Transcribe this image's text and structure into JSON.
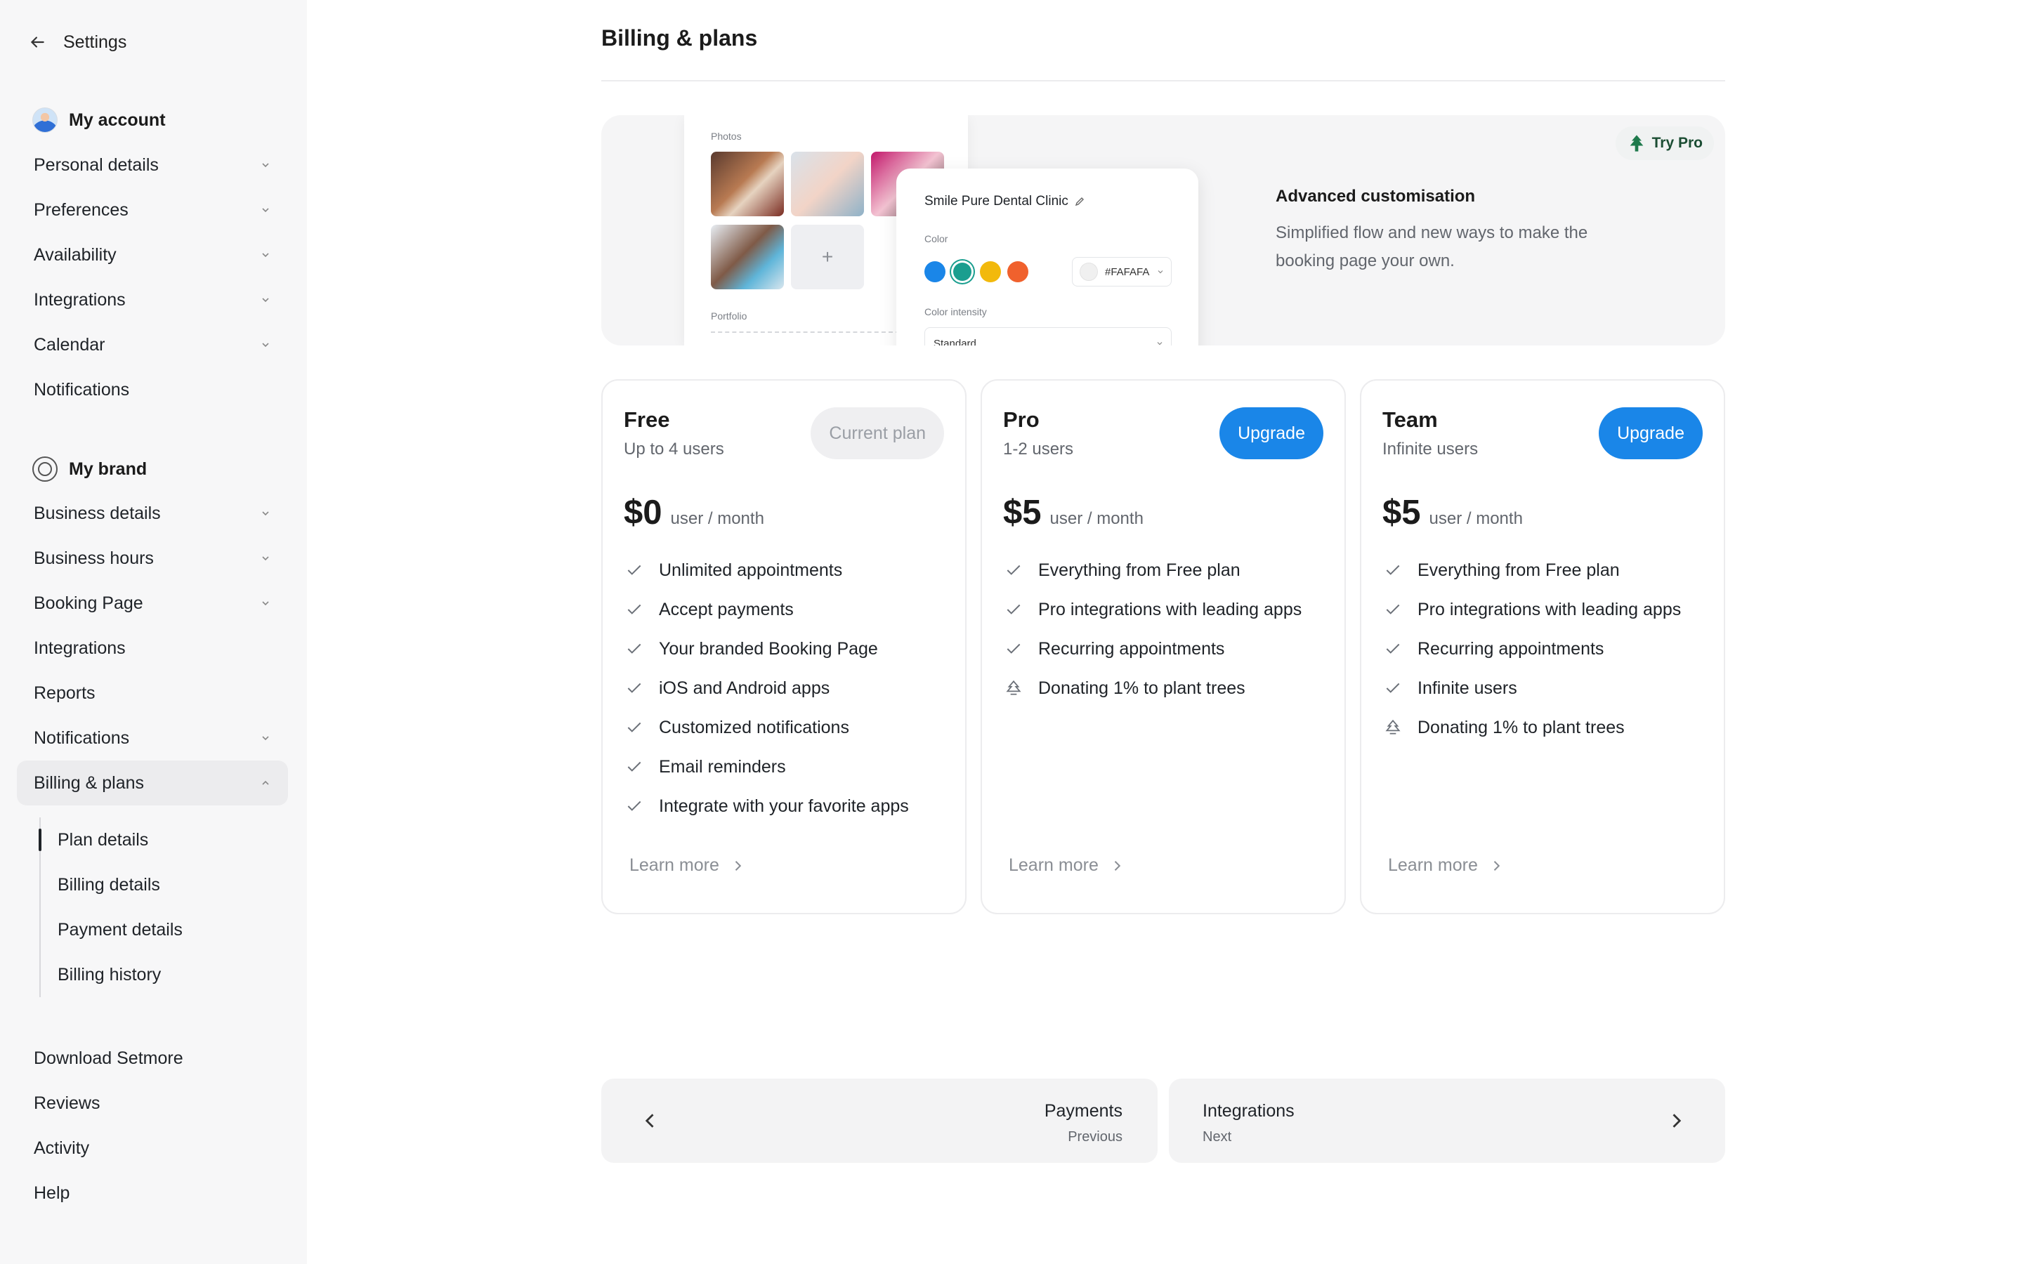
{
  "sidebar": {
    "back_label": "Settings",
    "my_account": {
      "title": "My account",
      "items": [
        {
          "label": "Personal details",
          "expandable": true
        },
        {
          "label": "Preferences",
          "expandable": true
        },
        {
          "label": "Availability",
          "expandable": true
        },
        {
          "label": "Integrations",
          "expandable": true
        },
        {
          "label": "Calendar",
          "expandable": true
        },
        {
          "label": "Notifications",
          "expandable": false
        }
      ]
    },
    "my_brand": {
      "title": "My brand",
      "items": [
        {
          "label": "Business details",
          "expandable": true
        },
        {
          "label": "Business hours",
          "expandable": true
        },
        {
          "label": "Booking Page",
          "expandable": true
        },
        {
          "label": "Integrations",
          "expandable": false
        },
        {
          "label": "Reports",
          "expandable": false
        },
        {
          "label": "Notifications",
          "expandable": true
        },
        {
          "label": "Billing & plans",
          "expandable": true,
          "expanded": true
        }
      ],
      "billing_sub": [
        "Plan details",
        "Billing details",
        "Payment details",
        "Billing history"
      ]
    },
    "footer_items": [
      "Download Setmore",
      "Reviews",
      "Activity",
      "Help"
    ]
  },
  "main": {
    "title": "Billing & plans",
    "promo": {
      "badge": "Try Pro",
      "title": "Advanced customisation",
      "description": "Simplified flow and new ways to make the booking page your own.",
      "mock": {
        "photos_label": "Photos",
        "portfolio_label": "Portfolio",
        "clinic_name": "Smile Pure Dental Clinic",
        "color_label": "Color",
        "hex_value": "#FAFAFA",
        "intensity_label": "Color intensity",
        "intensity_value": "Standard",
        "swatches": [
          "#1a86e8",
          "#1a9e8f",
          "#f2b90c",
          "#f0612d"
        ]
      }
    },
    "plans": [
      {
        "name": "Free",
        "users": "Up to 4 users",
        "button": "Current plan",
        "price": "$0",
        "unit": "user / month",
        "features": [
          {
            "text": "Unlimited appointments",
            "icon": "check-icon"
          },
          {
            "text": "Accept payments",
            "icon": "check-icon"
          },
          {
            "text": "Your branded Booking Page",
            "icon": "check-icon"
          },
          {
            "text": "iOS and Android apps",
            "icon": "check-icon"
          },
          {
            "text": "Customized notifications",
            "icon": "check-icon"
          },
          {
            "text": "Email reminders",
            "icon": "check-icon"
          },
          {
            "text": "Integrate with your favorite apps",
            "icon": "check-icon"
          }
        ],
        "learn_more": "Learn more"
      },
      {
        "name": "Pro",
        "users": "1-2 users",
        "button": "Upgrade",
        "price": "$5",
        "unit": "user / month",
        "features": [
          {
            "text": "Everything from Free plan",
            "icon": "check-icon"
          },
          {
            "text": "Pro integrations with leading apps",
            "icon": "check-icon"
          },
          {
            "text": "Recurring appointments",
            "icon": "check-icon"
          },
          {
            "text": "Donating 1% to plant trees",
            "icon": "tree-icon"
          }
        ],
        "learn_more": "Learn more"
      },
      {
        "name": "Team",
        "users": "Infinite users",
        "button": "Upgrade",
        "price": "$5",
        "unit": "user / month",
        "features": [
          {
            "text": "Everything from Free plan",
            "icon": "check-icon"
          },
          {
            "text": "Pro integrations with leading apps",
            "icon": "check-icon"
          },
          {
            "text": "Recurring appointments",
            "icon": "check-icon"
          },
          {
            "text": "Infinite users",
            "icon": "check-icon"
          },
          {
            "text": "Donating 1% to plant trees",
            "icon": "tree-icon"
          }
        ],
        "learn_more": "Learn more"
      }
    ],
    "pager": {
      "previous": {
        "title": "Payments",
        "label": "Previous"
      },
      "next": {
        "title": "Integrations",
        "label": "Next"
      }
    }
  },
  "colors": {
    "accent": "#1a86e8",
    "sidebar_bg": "#f7f7f8",
    "pro_badge": "#1b4d33"
  }
}
